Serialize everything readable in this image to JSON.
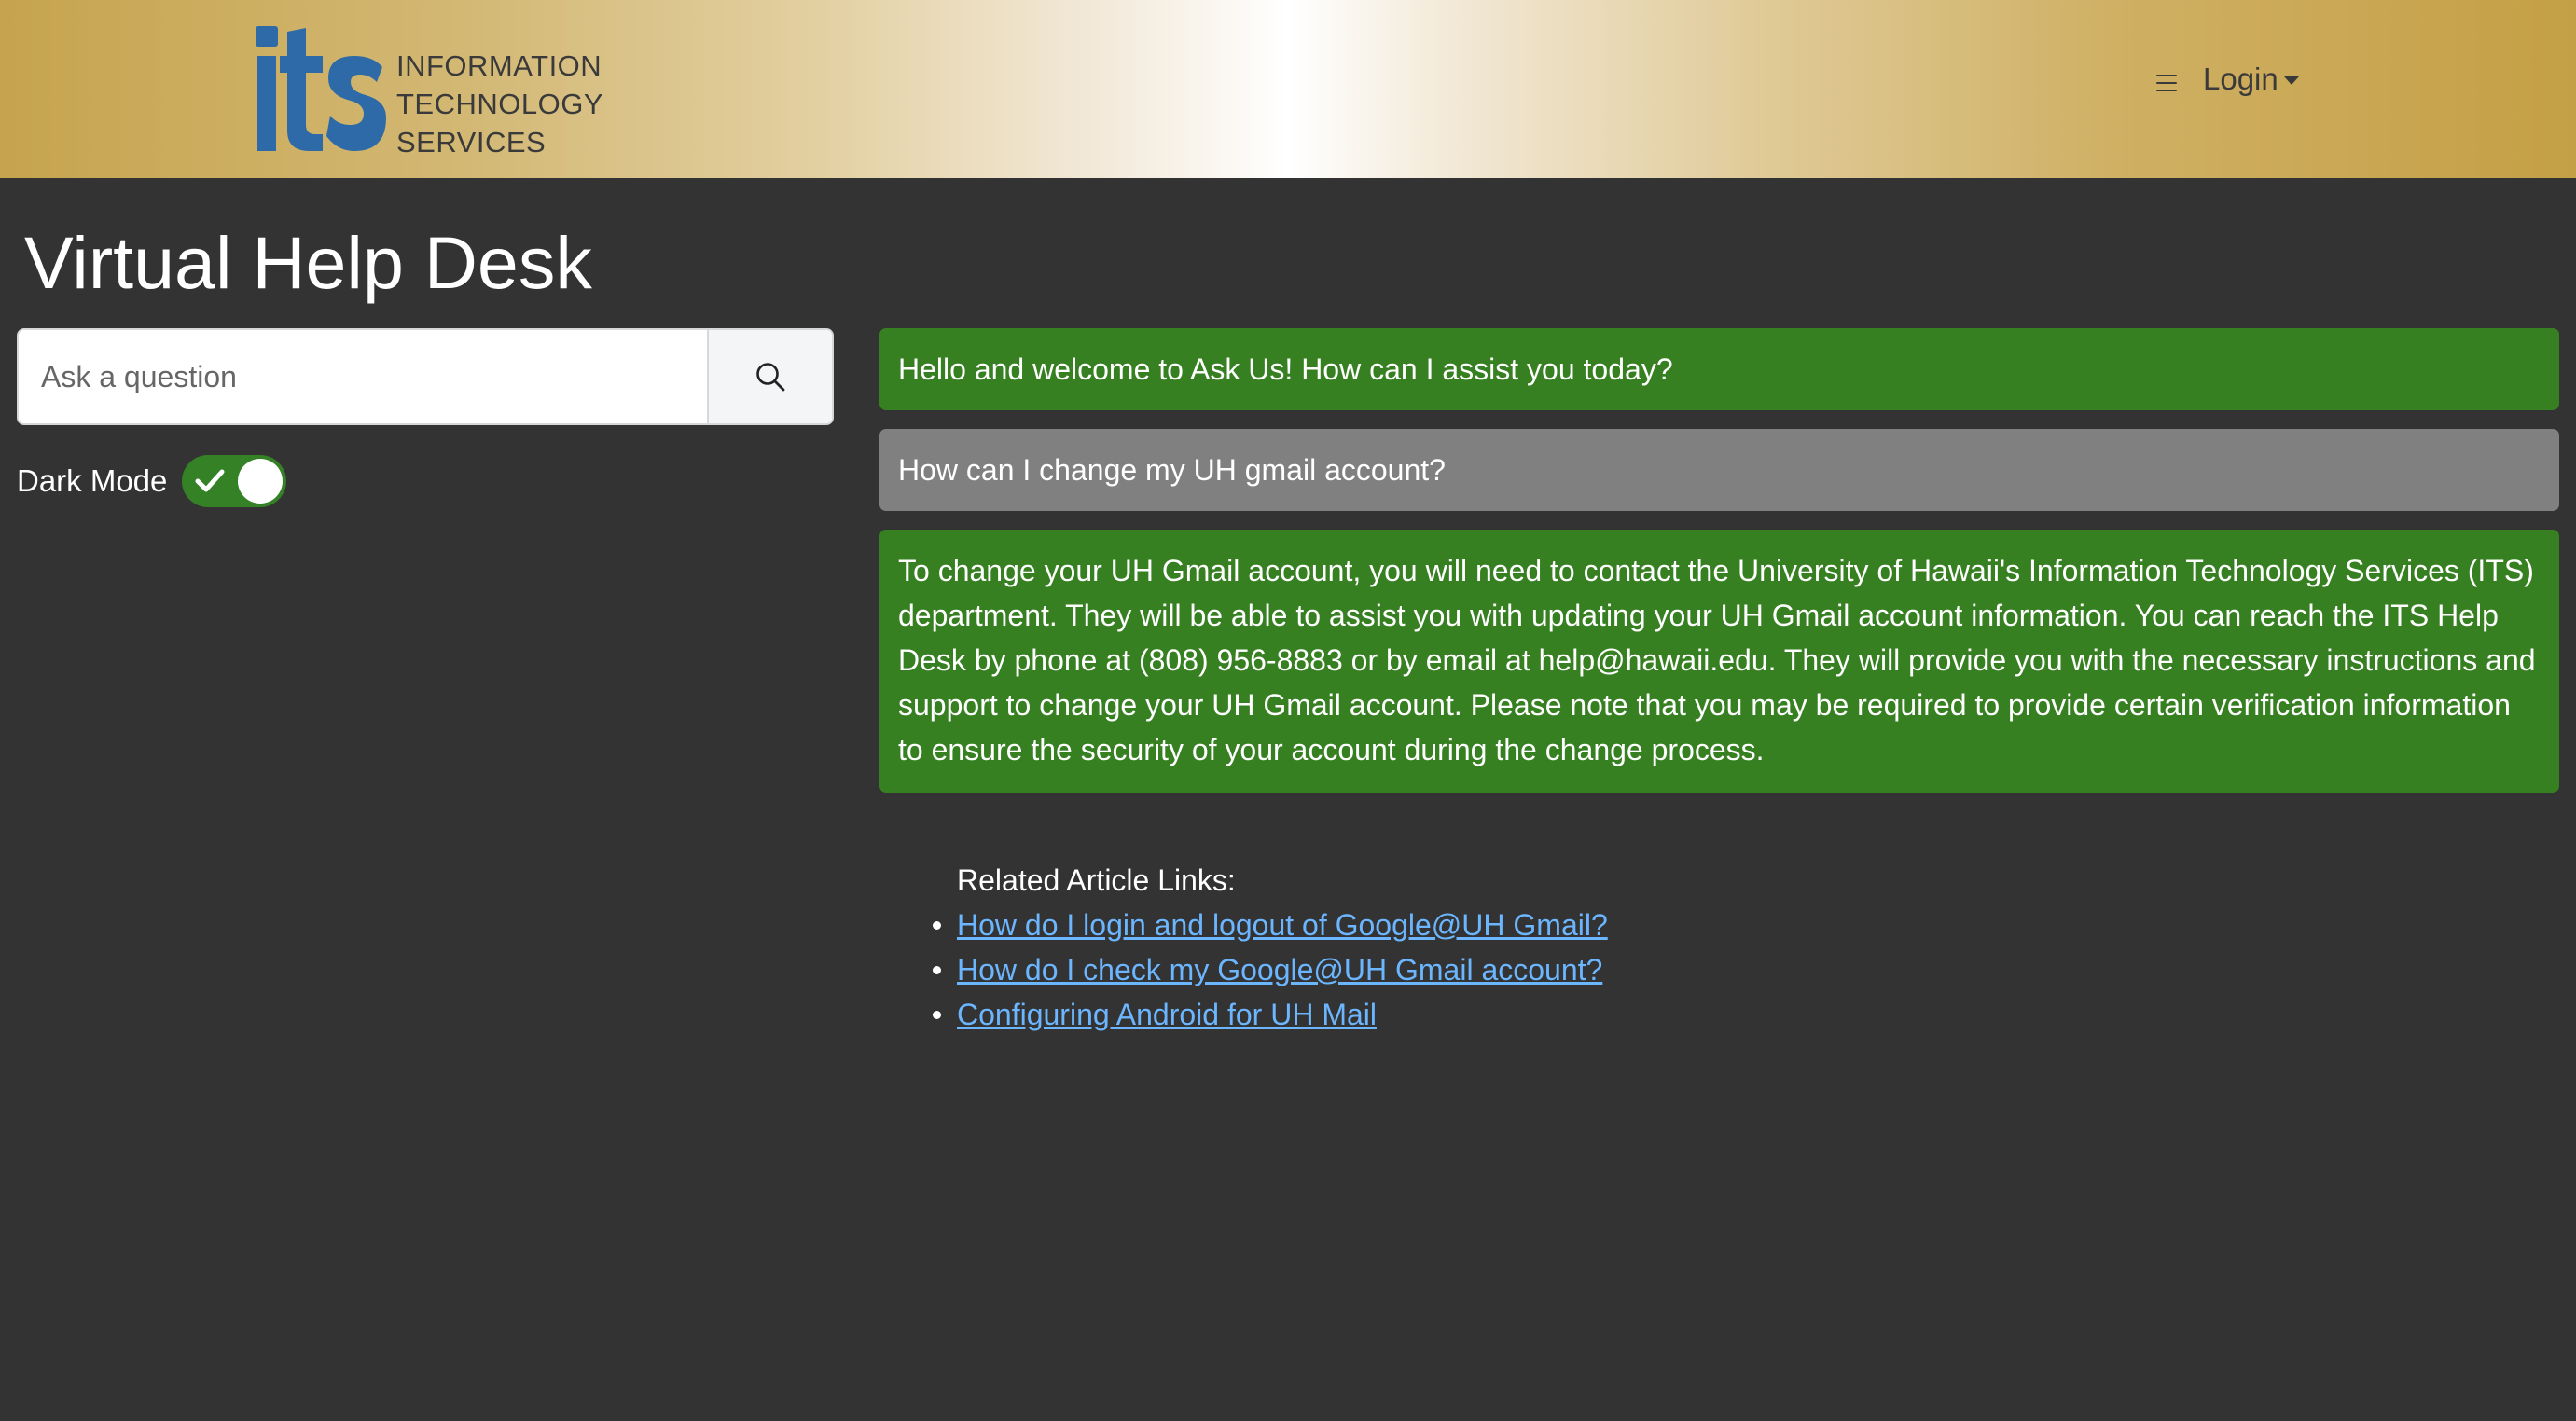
{
  "header": {
    "logo": {
      "mark": "its",
      "lines": [
        "INFORMATION",
        "TECHNOLOGY",
        "SERVICES"
      ]
    },
    "menu_icon": "hamburger-menu-icon",
    "login_label": "Login"
  },
  "page": {
    "title": "Virtual Help Desk"
  },
  "search": {
    "placeholder": "Ask a question",
    "value": "",
    "icon": "search-icon"
  },
  "dark_mode": {
    "label": "Dark Mode",
    "enabled": true
  },
  "chat": {
    "messages": [
      {
        "role": "bot",
        "text": "Hello and welcome to Ask Us! How can I assist you today?"
      },
      {
        "role": "user",
        "text": "How can I change my UH gmail account?"
      },
      {
        "role": "bot",
        "text": "To change your UH Gmail account, you will need to contact the University of Hawaii's Information Technology Services (ITS) department. They will be able to assist you with updating your UH Gmail account information. You can reach the ITS Help Desk by phone at (808) 956-8883 or by email at help@hawaii.edu. They will provide you with the necessary instructions and support to change your UH Gmail account. Please note that you may be required to provide certain verification information to ensure the security of your account during the change process."
      }
    ]
  },
  "related": {
    "heading": "Related Article Links:",
    "links": [
      "How do I login and logout of Google@UH Gmail?",
      "How do I check my Google@UH Gmail account?",
      "Configuring Android for UH Mail"
    ]
  },
  "colors": {
    "background": "#333333",
    "bot_bubble": "#378022",
    "user_bubble": "#808080",
    "link": "#6cb6ff",
    "toggle_on": "#348126"
  }
}
